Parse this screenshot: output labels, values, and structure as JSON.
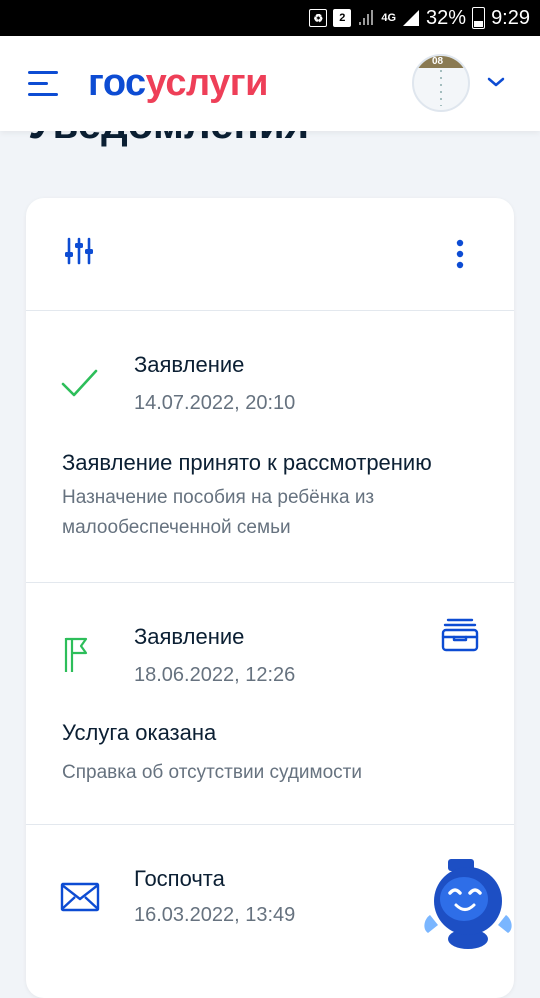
{
  "status_bar": {
    "sim_badge": "2",
    "network": "4G",
    "battery": "32%",
    "time": "9:29"
  },
  "header": {
    "logo_part1": "гос",
    "logo_part2": "услуги",
    "avatar_label": "08"
  },
  "page": {
    "title": "Уведомления"
  },
  "notifications": [
    {
      "type": "Заявление",
      "date": "14.07.2022, 20:10",
      "title": "Заявление принято к рассмотрению",
      "description": "Назначение пособия на ребёнка из малообеспеченной семьи",
      "icon": "checkmark-icon",
      "icon_color": "#2dbe5a"
    },
    {
      "type": "Заявление",
      "date": "18.06.2022, 12:26",
      "title": "Услуга оказана",
      "description": "Справка об отсутствии судимости",
      "icon": "flag-icon",
      "icon_color": "#2dbe5a"
    },
    {
      "type": "Госпочта",
      "date": "16.03.2022, 13:49",
      "icon": "envelope-icon",
      "icon_color": "#0d4cd3"
    }
  ],
  "colors": {
    "brand_blue": "#0d4cd3",
    "brand_red": "#ee3f58",
    "success_green": "#2dbe5a",
    "text_primary": "#0b1f33",
    "text_secondary": "#66727f",
    "background": "#f1f4f8"
  }
}
